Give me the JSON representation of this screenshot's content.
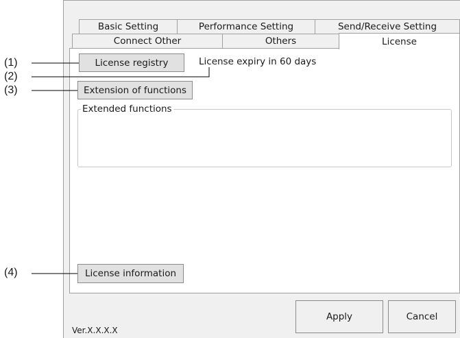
{
  "tabs_row1": [
    "Basic Setting",
    "Performance Setting",
    "Send/Receive Setting"
  ],
  "tabs_row2": [
    "Connect Other",
    "Others",
    "License"
  ],
  "license": {
    "registry_button": "License registry",
    "expiry_text": "License expiry in 60 days",
    "extension_button": "Extension of functions",
    "extended_group_label": "Extended functions",
    "info_button": "License information"
  },
  "footer": {
    "apply_label": "Apply",
    "cancel_label": "Cancel",
    "version": "Ver.X.X.X.X"
  },
  "callouts": [
    "(1)",
    "(2)",
    "(3)",
    "(4)"
  ]
}
